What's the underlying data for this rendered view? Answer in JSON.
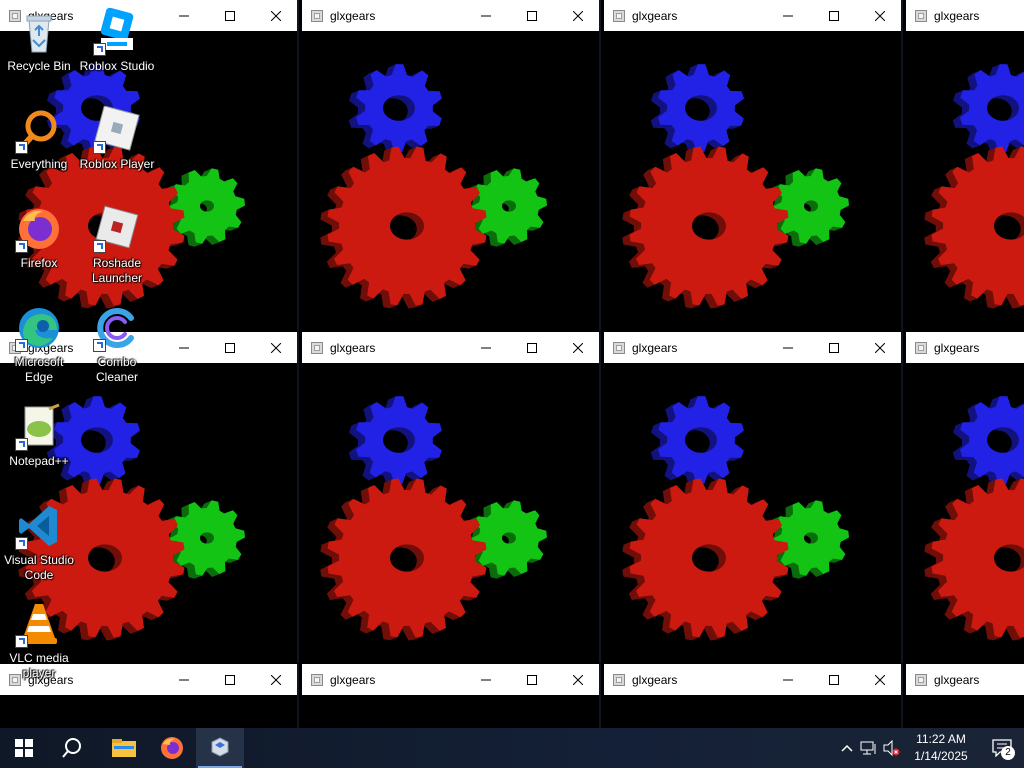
{
  "windows": [
    {
      "title": "glxgears"
    },
    {
      "title": "glxgears"
    },
    {
      "title": "glxgears"
    },
    {
      "title": "glxgears"
    },
    {
      "title": "glxgears"
    },
    {
      "title": "glxgears"
    },
    {
      "title": "glxgears"
    },
    {
      "title": "glxgears"
    },
    {
      "title": "glxgears"
    },
    {
      "title": "glxgears"
    },
    {
      "title": "glxgears"
    },
    {
      "title": "glxgears"
    }
  ],
  "window_controls": [
    "minimize-icon",
    "maximize-icon",
    "close-icon"
  ],
  "gear_colors": {
    "red": "#cc1a10",
    "green": "#14c414",
    "blue": "#2222e6"
  },
  "desktop_icons": [
    {
      "label": "Recycle Bin",
      "icon": "recycle-bin-icon"
    },
    {
      "label": "Roblox Studio",
      "icon": "roblox-studio-icon"
    },
    {
      "label": "Everything",
      "icon": "everything-search-icon"
    },
    {
      "label": "Roblox Player",
      "icon": "roblox-player-icon"
    },
    {
      "label": "Firefox",
      "icon": "firefox-icon"
    },
    {
      "label": "Roshade Launcher",
      "icon": "roshade-launcher-icon"
    },
    {
      "label": "Microsoft Edge",
      "icon": "edge-icon"
    },
    {
      "label": "Combo Cleaner",
      "icon": "combo-cleaner-icon"
    },
    {
      "label": "Notepad++",
      "icon": "notepad-plus-plus-icon"
    },
    {
      "label": "Visual Studio Code",
      "icon": "vscode-icon"
    },
    {
      "label": "VLC media player",
      "icon": "vlc-icon"
    }
  ],
  "taskbar": {
    "items": [
      "start-icon",
      "search-icon",
      "file-explorer-icon",
      "firefox-icon",
      "glxgears-app-icon"
    ],
    "tray": [
      "chevron-up-icon",
      "network-icon",
      "volume-muted-icon"
    ],
    "time": "11:22 AM",
    "date": "1/14/2025",
    "notification_count": "2"
  }
}
